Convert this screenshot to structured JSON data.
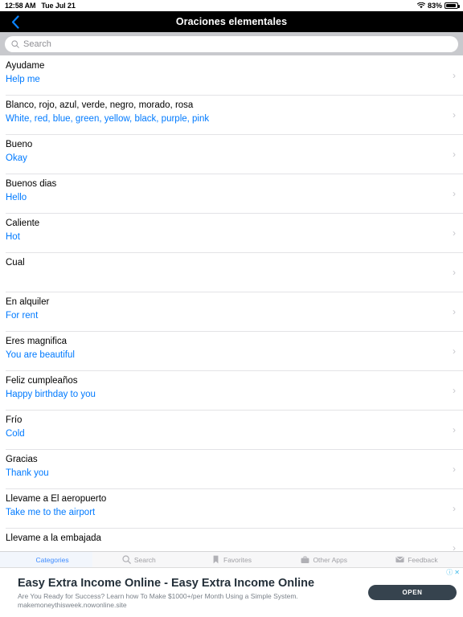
{
  "status_bar": {
    "time": "12:58 AM",
    "date": "Tue Jul 21",
    "wifi_icon": "wifi-icon",
    "battery_percent": "83%",
    "battery_icon": "battery-icon"
  },
  "nav": {
    "back_icon": "chevron-left-icon",
    "title": "Oraciones elementales"
  },
  "search": {
    "icon": "search-icon",
    "placeholder": "Search",
    "value": ""
  },
  "list": {
    "disclosure_icon": "chevron-right-icon",
    "rows": [
      {
        "term": "Ayudame",
        "translation": "Help me"
      },
      {
        "term": "Blanco, rojo, azul, verde, negro, morado, rosa",
        "translation": "White, red, blue, green, yellow, black, purple, pink"
      },
      {
        "term": "Bueno",
        "translation": "Okay"
      },
      {
        "term": "Buenos dias",
        "translation": "Hello"
      },
      {
        "term": "Caliente",
        "translation": "Hot"
      },
      {
        "term": "Cual",
        "translation": ""
      },
      {
        "term": "En alquiler",
        "translation": "For rent"
      },
      {
        "term": "Eres magnifica",
        "translation": "You are beautiful"
      },
      {
        "term": "Feliz cumpleaños",
        "translation": "Happy birthday to you"
      },
      {
        "term": "Frío",
        "translation": "Cold"
      },
      {
        "term": "Gracias",
        "translation": "Thank you"
      },
      {
        "term": "Llevame a El aeropuerto",
        "translation": "Take me to the airport"
      },
      {
        "term": "Llevame a la embajada",
        "translation": ""
      }
    ]
  },
  "tabs": [
    {
      "label": "Categories",
      "icon": "grid-icon",
      "active": true
    },
    {
      "label": "Search",
      "icon": "search-icon",
      "active": false
    },
    {
      "label": "Favorites",
      "icon": "bookmark-icon",
      "active": false
    },
    {
      "label": "Other Apps",
      "icon": "briefcase-icon",
      "active": false
    },
    {
      "label": "Feedback",
      "icon": "envelope-icon",
      "active": false
    }
  ],
  "ad": {
    "title": "Easy Extra Income Online - Easy Extra Income Online",
    "subtitle": "Are You Ready for Success? Learn how To Make $1000+/per Month Using a Simple System.",
    "url": "makemoneythisweek.nowonline.site",
    "cta_label": "OPEN",
    "info_icon": "info-circle-icon",
    "close_icon": "close-icon"
  },
  "colors": {
    "accent_blue": "#007aff",
    "navbar_black": "#000000",
    "tab_active": "#3d8bff",
    "ad_dark": "#36434e"
  }
}
